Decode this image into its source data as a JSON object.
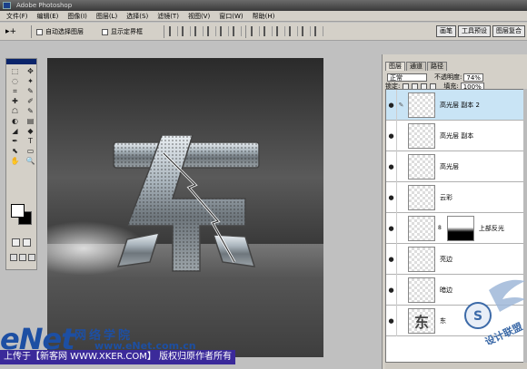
{
  "titlebar": {
    "title": "Adobe Photoshop"
  },
  "menubar": {
    "items": [
      "文件(F)",
      "编辑(E)",
      "图像(I)",
      "图层(L)",
      "选择(S)",
      "滤镜(T)",
      "视图(V)",
      "窗口(W)",
      "帮助(H)"
    ]
  },
  "options": {
    "tool_symbol": "▸+",
    "auto_select_layer": "自动选择图层",
    "show_bounds": "显示定界框"
  },
  "wells": {
    "items": [
      "画笔",
      "工具预设",
      "图层复合"
    ]
  },
  "toolbox": {
    "tools": [
      "⬚",
      "✥",
      "◌",
      "✦",
      "⌗",
      "✎",
      "✚",
      "✐",
      "☖",
      "✎",
      "◐",
      "▤",
      "◢",
      "◆",
      "✒",
      "T",
      "⬉",
      "▭",
      "✋",
      "🔍"
    ]
  },
  "layers_panel": {
    "tabs": [
      "图层",
      "通道",
      "路径"
    ],
    "blend_mode": "正常",
    "opacity_label": "不透明度:",
    "opacity_value": "74%",
    "lock_label": "锁定:",
    "fill_label": "填充:",
    "fill_value": "100%",
    "layers": [
      {
        "name": "高光层 副本 2",
        "selected": true,
        "thumb": "checker"
      },
      {
        "name": "高光层 副本",
        "selected": false,
        "thumb": "checker"
      },
      {
        "name": "高光层",
        "selected": false,
        "thumb": "checker"
      },
      {
        "name": "云彩",
        "selected": false,
        "thumb": "checker"
      },
      {
        "name": "上部反光",
        "selected": false,
        "thumb": "gradient"
      },
      {
        "name": "亮边",
        "selected": false,
        "thumb": "checker"
      },
      {
        "name": "暗边",
        "selected": false,
        "thumb": "checker"
      },
      {
        "name": "东",
        "selected": false,
        "thumb": "text"
      }
    ]
  },
  "canvas": {
    "glyph": "东"
  },
  "watermark": {
    "brand": "eNet",
    "site_name": "网络学院",
    "domain": "www.eNet.com.cn"
  },
  "caption": {
    "text": "上传于【新客网 WWW.XKER.COM】 版权归原作者所有"
  },
  "logo": {
    "text": "S",
    "label": "设计联盟"
  }
}
